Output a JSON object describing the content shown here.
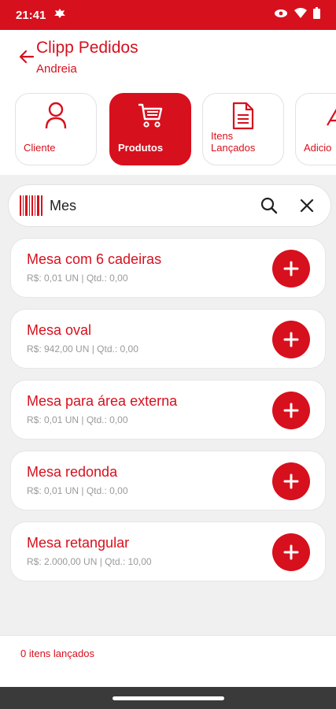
{
  "status_bar": {
    "time": "21:41",
    "icons": [
      "bug-icon",
      "eye-icon",
      "wifi-icon",
      "battery-icon"
    ]
  },
  "header": {
    "title": "Clipp Pedidos",
    "subtitle": "Andreia"
  },
  "tabs": [
    {
      "label": "Cliente",
      "icon": "person-icon",
      "active": false
    },
    {
      "label": "Produtos",
      "icon": "cart-icon",
      "active": true
    },
    {
      "label": "Itens\nLançados",
      "icon": "document-icon",
      "active": false
    },
    {
      "label": "Adicio",
      "icon": "plus-icon",
      "active": false
    }
  ],
  "search": {
    "value": "Mes"
  },
  "products": [
    {
      "name": "Mesa com 6 cadeiras",
      "meta": "R$: 0,01 UN |  Qtd.: 0,00"
    },
    {
      "name": "Mesa oval",
      "meta": "R$: 942,00 UN |  Qtd.: 0,00"
    },
    {
      "name": "Mesa para área externa",
      "meta": "R$: 0,01 UN |  Qtd.: 0,00"
    },
    {
      "name": "Mesa redonda",
      "meta": "R$: 0,01 UN |  Qtd.: 0,00"
    },
    {
      "name": "Mesa retangular",
      "meta": "R$: 2.000,00 UN |  Qtd.: 10,00"
    }
  ],
  "footer": {
    "items_count_text": "0 itens lançados"
  },
  "colors": {
    "accent": "#d7101d",
    "background": "#f0f0f0",
    "meta_text": "#9a9a9a"
  }
}
